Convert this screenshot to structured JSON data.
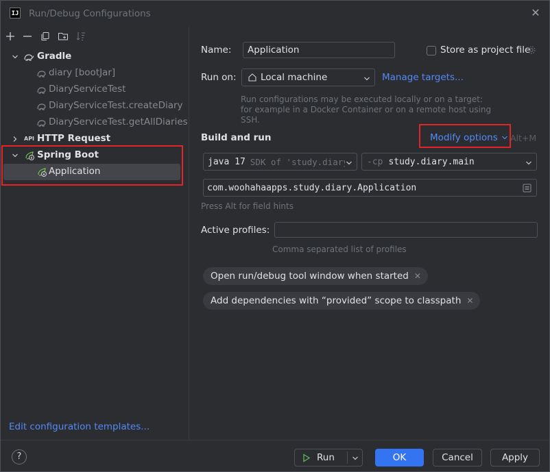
{
  "window": {
    "title": "Run/Debug Configurations",
    "app_icon_text": "IJ"
  },
  "tree": {
    "gradle": {
      "label": "Gradle",
      "children": [
        "diary [bootJar]",
        "DiaryServiceTest",
        "DiaryServiceTest.createDiary",
        "DiaryServiceTest.getAllDiaries"
      ]
    },
    "http": {
      "label": "HTTP Request",
      "icon_text": "API"
    },
    "spring": {
      "label": "Spring Boot",
      "children": [
        "Application"
      ]
    }
  },
  "left_footer": {
    "edit_templates": "Edit configuration templates..."
  },
  "form": {
    "name_label": "Name:",
    "name_value": "Application",
    "store_label": "Store as project file",
    "run_on_label": "Run on:",
    "run_on_value": "Local machine",
    "manage_targets": "Manage targets...",
    "run_on_hint": "Run configurations may be executed locally or on a target: for example in a Docker Container or on a remote host using SSH.",
    "build_run_label": "Build and run",
    "modify_options": "Modify options",
    "modify_shortcut": "Alt+M",
    "jdk_main": "java 17",
    "jdk_sdk": "SDK of 'study.diary'",
    "cp_prefix": "-cp",
    "cp_value": "study.diary.main",
    "main_class": "com.woohahaapps.study.diary.Application",
    "field_hint": "Press Alt for field hints",
    "profiles_label": "Active profiles:",
    "profiles_value": "",
    "profiles_hint": "Comma separated list of profiles",
    "chip1": "Open run/debug tool window when started",
    "chip2": "Add dependencies with “provided” scope to classpath"
  },
  "footer": {
    "help": "?",
    "run": "Run",
    "ok": "OK",
    "cancel": "Cancel",
    "apply": "Apply"
  },
  "colors": {
    "accent": "#3574f0",
    "link": "#548af7",
    "highlight": "#e5242a",
    "spring": "#6cbe45"
  }
}
